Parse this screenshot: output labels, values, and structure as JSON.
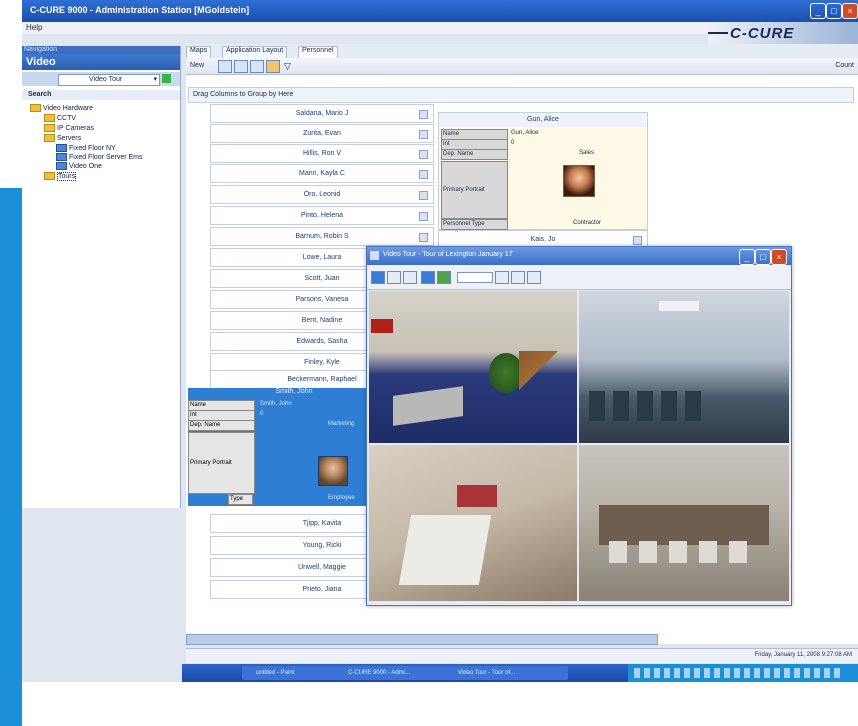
{
  "window": {
    "title": "C-CURE 9000 - Administration Station [MGoldstein]"
  },
  "menu": {
    "help": "Help"
  },
  "brand": {
    "logo": "C-CURE"
  },
  "navigation": {
    "header": "Navigation",
    "pane_title": "Video",
    "selector_value": "Video Tour",
    "search_label": "Search",
    "tree": [
      {
        "label": "Video Hardware",
        "depth": 0
      },
      {
        "label": "CCTV",
        "depth": 1
      },
      {
        "label": "IP Cameras",
        "depth": 1
      },
      {
        "label": "Servers",
        "depth": 1
      },
      {
        "label": "Fixed Floor NY",
        "depth": 2
      },
      {
        "label": "Fixed Floor Server Ems",
        "depth": 2
      },
      {
        "label": "Video One",
        "depth": 2
      },
      {
        "label": "Tours",
        "depth": 1
      }
    ]
  },
  "tabs": [
    "Maps",
    "Application Layout",
    "Personnel"
  ],
  "toolbar": {
    "new_label": "New",
    "count_label": "Count"
  },
  "group_hint": "Drag Columns to Group by Here",
  "personnel": [
    "Saldana, Mario J",
    "Zurita, Evan",
    "Hillis, Ron V",
    "Mann, Kayla C",
    "Oro, Leonid",
    "Pinto, Helena",
    "Barnum, Robin S",
    "Lowe, Laura",
    "Scott, Juan",
    "Parsons, Vanesa",
    "Bent, Nadine",
    "Edwards, Sasha",
    "Finley, Kyle",
    "Beckermann, Raphael"
  ],
  "personnel_after": [
    "Tjipp, Kavita",
    "Young, Ricki",
    "Unwell, Maggie",
    "Prieto, Jiana"
  ],
  "detail_top": {
    "header": "Gun, Alice",
    "rows": [
      {
        "label": "Name",
        "value": "Gun, Alice"
      },
      {
        "label": "Int",
        "value": "0"
      },
      {
        "label": "Dep. Name",
        "value": "Sales"
      },
      {
        "label": "Primary Portrait",
        "value": ""
      },
      {
        "label": "Personnel Type",
        "value": "Contractor"
      }
    ],
    "next_name": "Kais, Jo"
  },
  "detail_bottom": {
    "header": "Smith, John",
    "rows": [
      {
        "label": "Name",
        "value": "Smith, John"
      },
      {
        "label": "Int",
        "value": "0"
      },
      {
        "label": "Dep. Name",
        "value": "Marketing"
      },
      {
        "label": "Primary Portrait",
        "value": ""
      },
      {
        "label": "Type",
        "value": "Employee"
      }
    ]
  },
  "video_window": {
    "title": "Video Tour - Tour of Lexington January 17"
  },
  "status": {
    "datetime": "Friday, January 11, 2008 9:27:08 AM"
  },
  "taskbar": [
    {
      "label": "untitled - Paint"
    },
    {
      "label": "C-CURE 9000 - Admi..."
    },
    {
      "label": "Video Tour - Tour of..."
    }
  ],
  "colors": {
    "title_bar": "#2f6fd4",
    "left_accent": "#1b8fd8",
    "selected_card": "#2e7fd4"
  }
}
